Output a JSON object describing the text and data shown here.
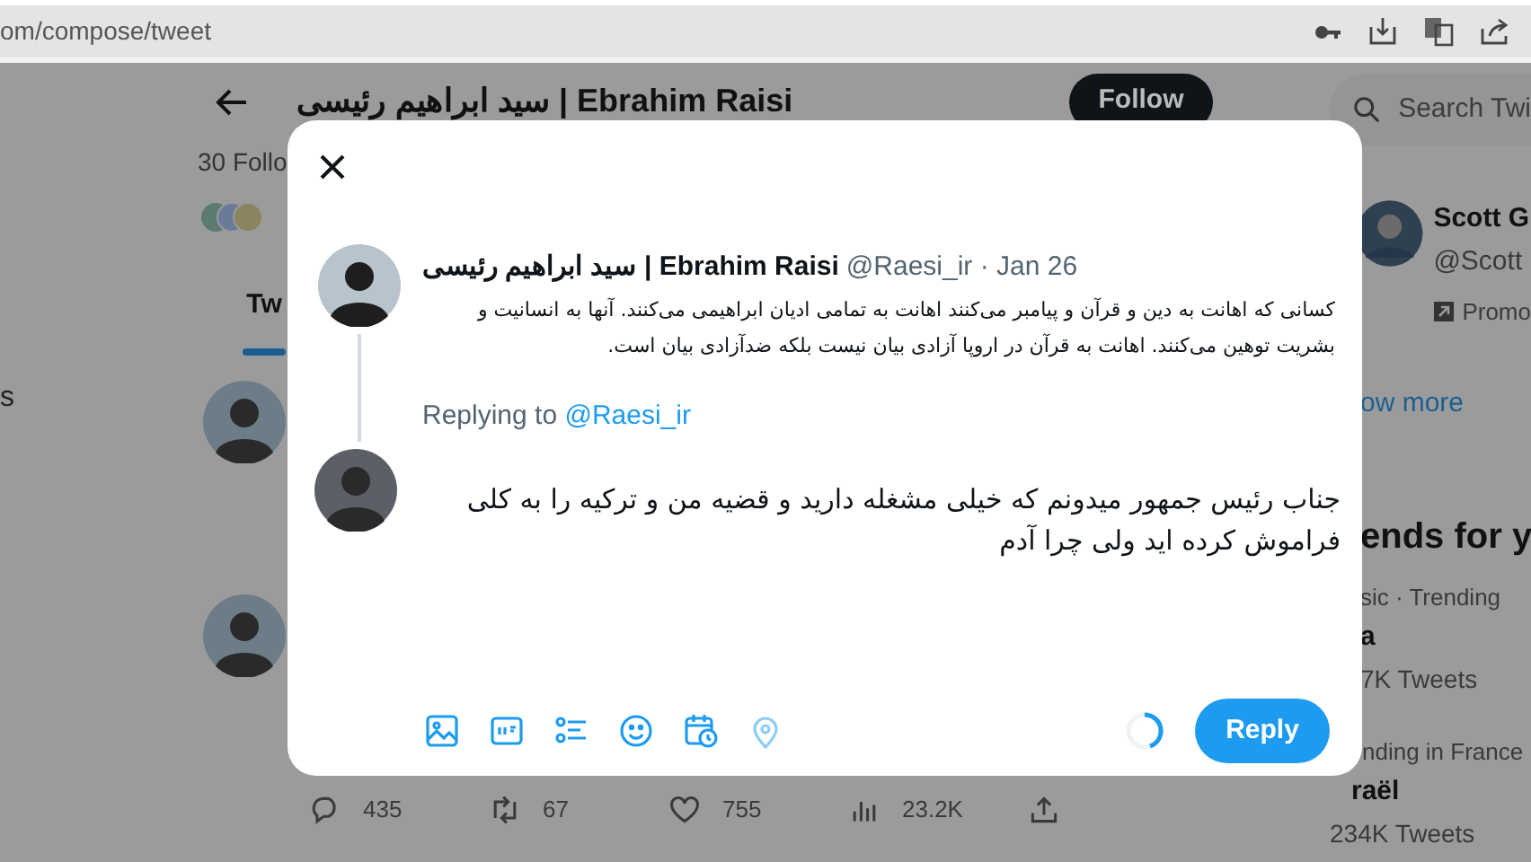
{
  "browser": {
    "url": "om/compose/tweet"
  },
  "page": {
    "side_text": "s",
    "title": "سید ابراهیم رئیسی | Ebrahim Raisi",
    "follow_button": "Follow",
    "followers": "30 Follo",
    "tabs": [
      {
        "label": "Tw",
        "selected": true
      }
    ],
    "actions": [
      {
        "kind": "reply",
        "count": "435"
      },
      {
        "kind": "retweet",
        "count": "67"
      },
      {
        "kind": "like",
        "count": "755"
      },
      {
        "kind": "views",
        "count": "23.2K"
      },
      {
        "kind": "share"
      }
    ]
  },
  "sidebar": {
    "search": {
      "placeholder": "Search Twi"
    },
    "suggestion": {
      "name": "Scott G",
      "handle": "@Scott",
      "promoted": "Promo"
    },
    "show_more": "ow more",
    "trends_title": "ends for y",
    "trends": [
      {
        "context": "sic · Trending",
        "name": "a",
        "count": "7K Tweets"
      },
      {
        "context": "nding in France",
        "name": "raël",
        "count": "234K Tweets"
      }
    ]
  },
  "dialog": {
    "tweet": {
      "name": "سید ابراهیم رئیسی | Ebrahim Raisi",
      "meta": "@Raesi_ir · Jan 26",
      "text": "کسانی که اهانت به دین و قرآن و پیامبر می‌کنند اهانت به تمامی ادیان ابراهیمی می‌کنند. آنها به انسانیت و بشریت توهین می‌کنند. اهانت به قرآن در اروپا آزادی بیان نیست بلکه ضدآزادی بیان است."
    },
    "replying_to": {
      "label": "Replying to",
      "handle": "@Raesi_ir"
    },
    "draft": "جناب رئیس جمهور میدونم که خیلی مشغله دارید و قضیه من و ترکیه را به کلی فراموش کرده اید ولی چرا آدم",
    "tools": [
      {
        "kind": "image",
        "disabled": false
      },
      {
        "kind": "gif",
        "disabled": false
      },
      {
        "kind": "poll",
        "disabled": false
      },
      {
        "kind": "emoji",
        "disabled": false
      },
      {
        "kind": "schedule",
        "disabled": false
      },
      {
        "kind": "location",
        "disabled": true
      }
    ],
    "reply_button": "Reply"
  }
}
